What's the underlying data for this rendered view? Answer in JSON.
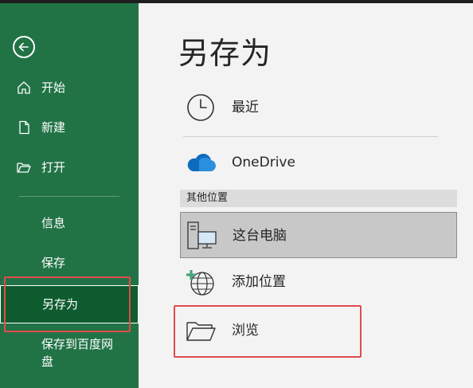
{
  "sidebar": {
    "back_icon": "back-arrow-icon",
    "items": [
      {
        "label": "开始",
        "icon": "home-icon"
      },
      {
        "label": "新建",
        "icon": "new-document-icon"
      },
      {
        "label": "打开",
        "icon": "open-folder-icon"
      },
      {
        "label": "信息"
      },
      {
        "label": "保存"
      },
      {
        "label": "另存为",
        "selected": true
      },
      {
        "label": "保存到百度网盘"
      }
    ]
  },
  "main": {
    "title": "另存为",
    "locations": [
      {
        "label": "最近",
        "icon": "clock-icon"
      },
      {
        "label": "OneDrive",
        "icon": "cloud-icon"
      }
    ],
    "other_locations_header": "其他位置",
    "other_locations": [
      {
        "label": "这台电脑",
        "icon": "computer-icon",
        "selected": true
      },
      {
        "label": "添加位置",
        "icon": "add-location-globe-icon"
      },
      {
        "label": "浏览",
        "icon": "browse-folder-icon"
      }
    ]
  },
  "colors": {
    "sidebar_bg": "#217346",
    "sidebar_selected": "#0e5c2f",
    "highlight_red": "#e24b4b",
    "onedrive_blue": "#0f6cbd"
  }
}
